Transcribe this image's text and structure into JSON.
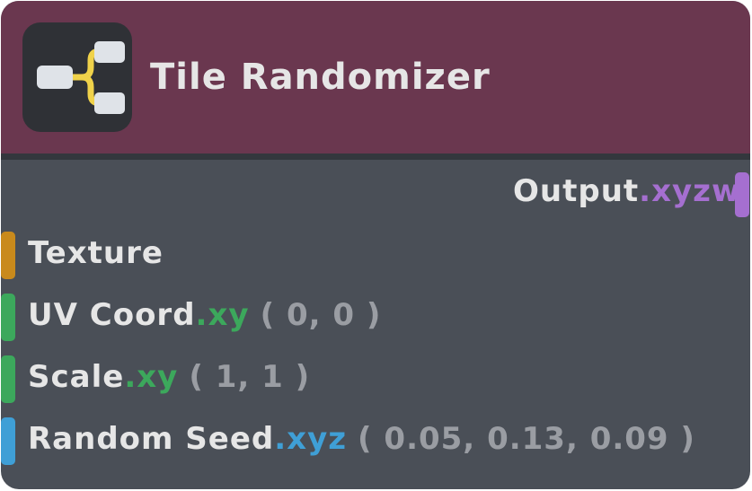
{
  "node": {
    "title": "Tile Randomizer",
    "icon": "branch-split-icon",
    "colors": {
      "header": "#6a374f",
      "body": "#4a4f57",
      "text": "#e6e6e6",
      "default_value": "#9a9da3"
    },
    "output": {
      "label": "Output",
      "swizzle": ".xyzw",
      "color": "#a56fd0"
    },
    "inputs": [
      {
        "label": "Texture",
        "swizzle": "",
        "default": "",
        "color": "#c98a1c"
      },
      {
        "label": "UV Coord",
        "swizzle": ".xy",
        "default": "( 0, 0 )",
        "color": "#3ca85c"
      },
      {
        "label": "Scale",
        "swizzle": ".xy",
        "default": "( 1, 1 )",
        "color": "#3ca85c"
      },
      {
        "label": "Random Seed",
        "swizzle": ".xyz",
        "default": "( 0.05, 0.13, 0.09 )",
        "color": "#3f9fd6"
      }
    ]
  }
}
